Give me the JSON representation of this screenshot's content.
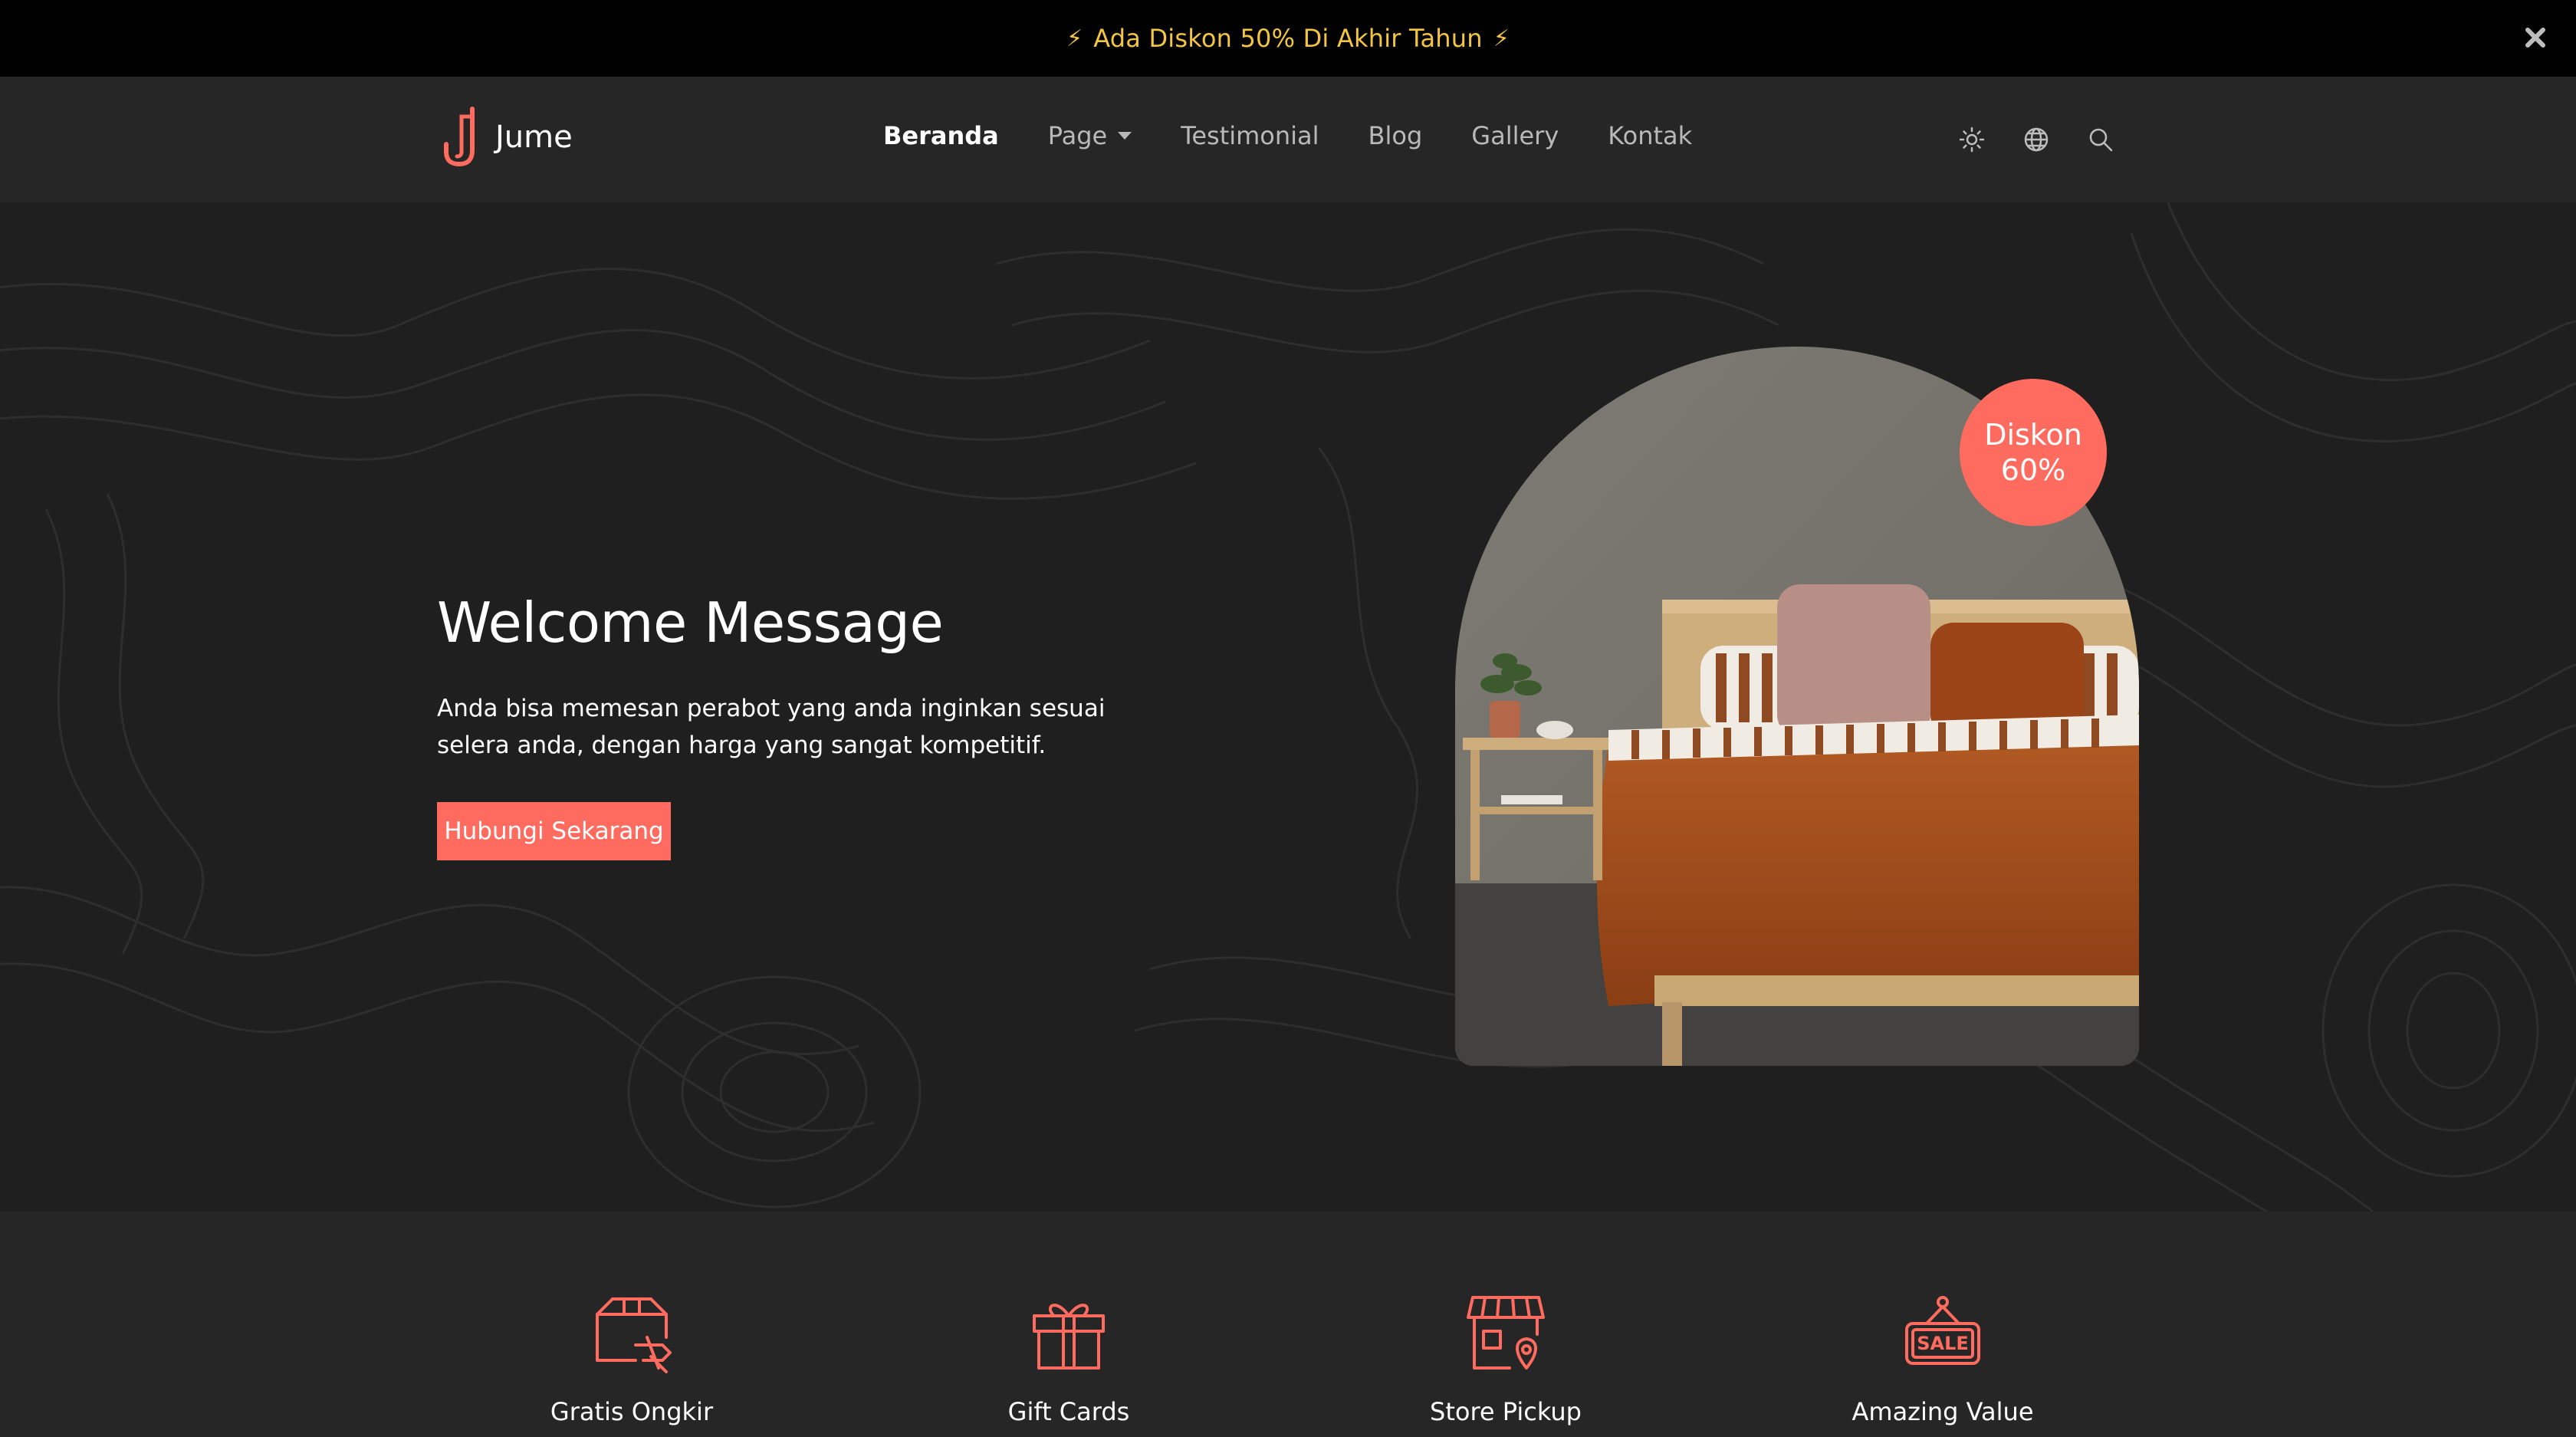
{
  "announcement": {
    "text": "Ada Diskon 50% Di Akhir Tahun",
    "bolt": "⚡"
  },
  "header": {
    "logo_text": "Jume",
    "nav": [
      {
        "label": "Beranda"
      },
      {
        "label": "Page"
      },
      {
        "label": "Testimonial"
      },
      {
        "label": "Blog"
      },
      {
        "label": "Gallery"
      },
      {
        "label": "Kontak"
      }
    ],
    "icons": [
      "sun-icon",
      "globe-icon",
      "search-icon"
    ]
  },
  "hero": {
    "title": "Welcome Message",
    "description": "Anda bisa memesan perabot yang anda inginkan sesuai selera anda, dengan harga yang sangat kompetitif.",
    "cta_label": "Hubungi Sekarang",
    "badge_text": "Diskon 60%"
  },
  "features": [
    {
      "label": "Gratis Ongkir",
      "icon": "delivery-box-icon"
    },
    {
      "label": "Gift Cards",
      "icon": "gift-icon"
    },
    {
      "label": "Store Pickup",
      "icon": "store-pickup-icon"
    },
    {
      "label": "Amazing Value",
      "icon": "sale-tag-icon"
    }
  ],
  "colors": {
    "accent": "#ff6b5e",
    "announcement_text": "#f4c542",
    "background": "#1f1f1f",
    "header_bg": "#262626"
  }
}
